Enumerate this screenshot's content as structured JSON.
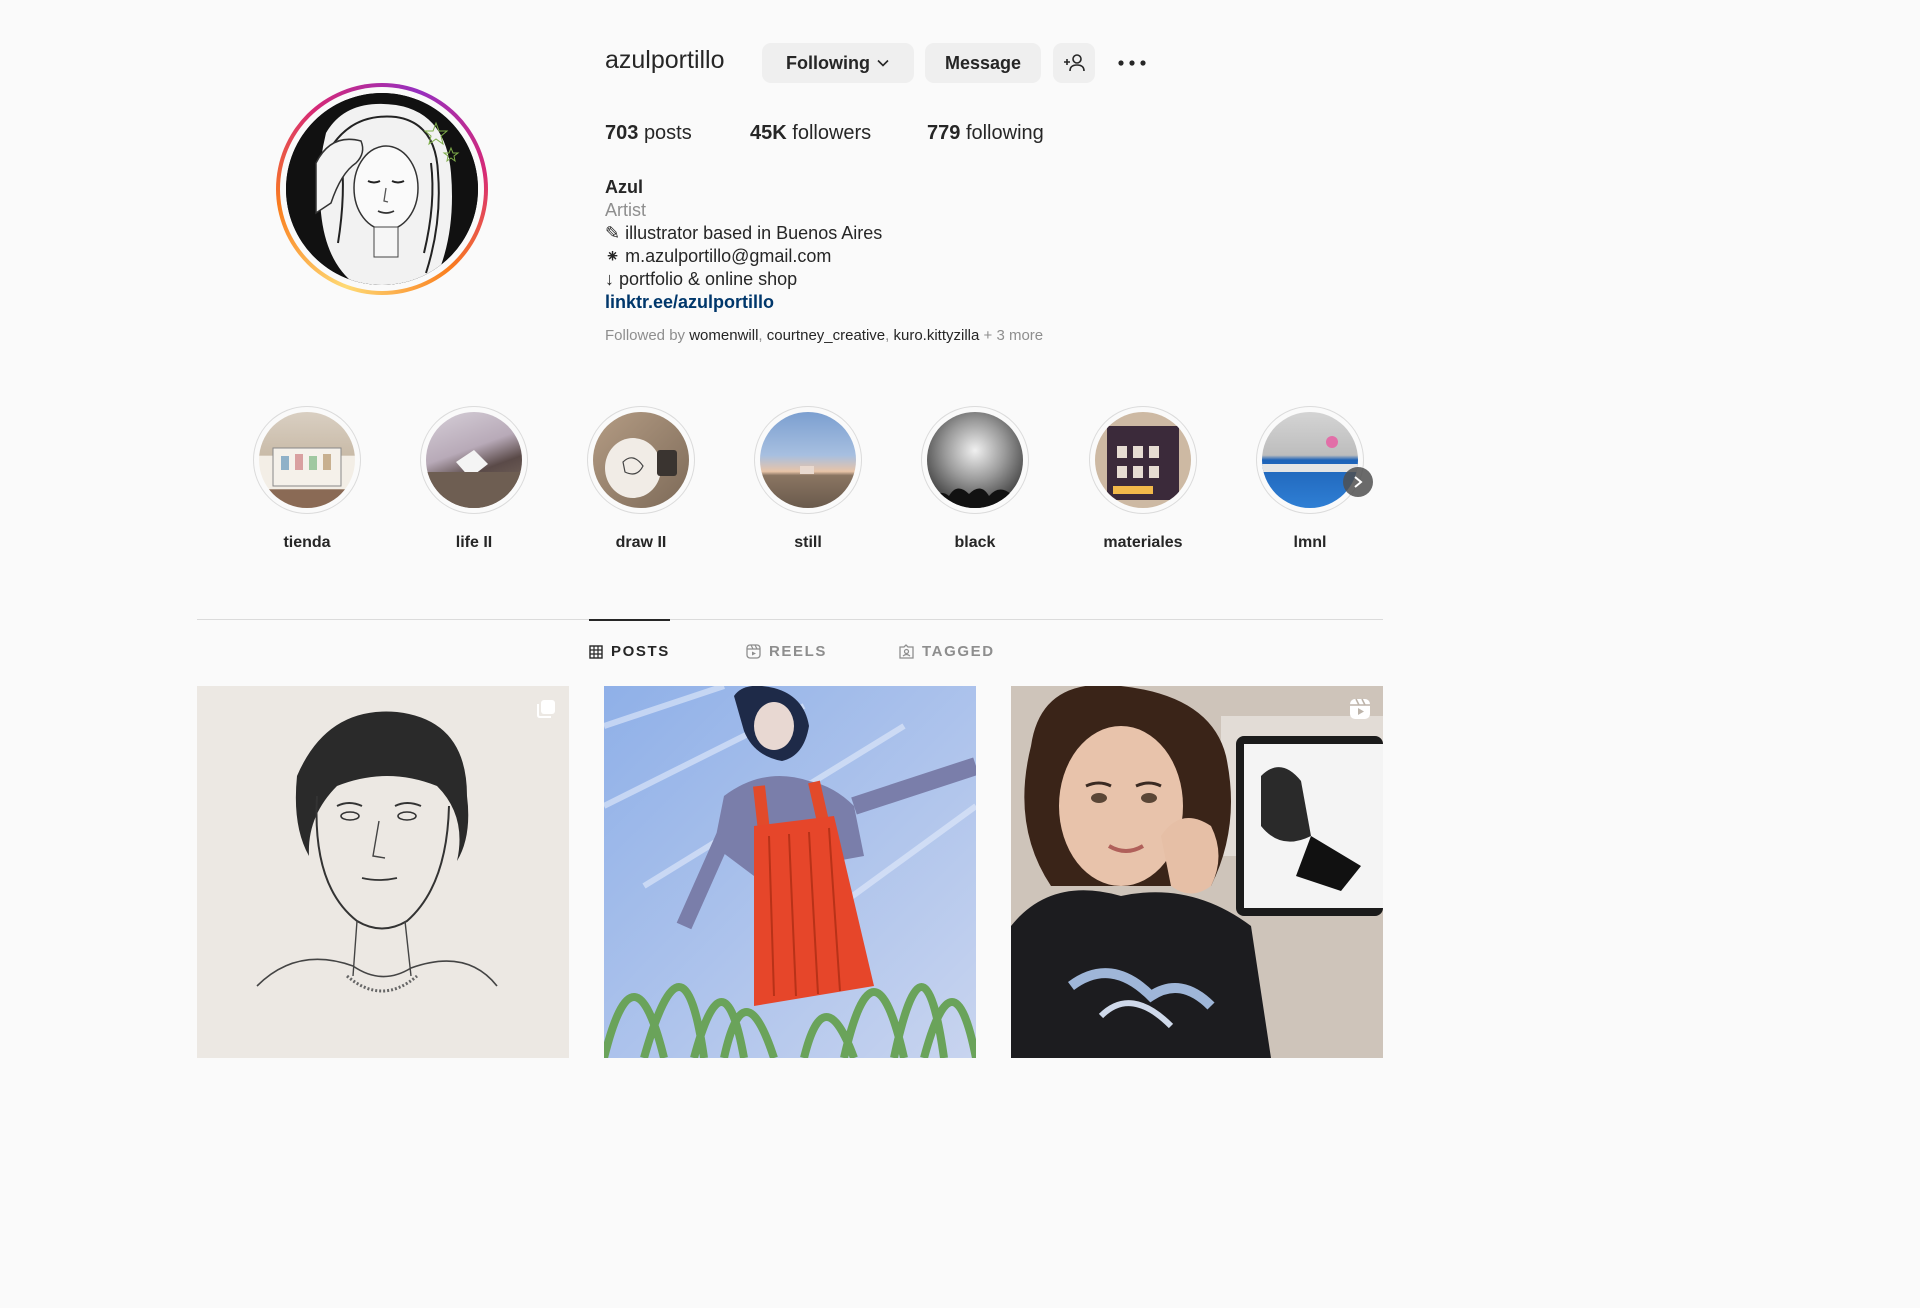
{
  "profile": {
    "username": "azulportillo",
    "following_button": "Following",
    "message_button": "Message",
    "add_user_icon": "add-user-icon",
    "more_icon": "more-options-icon",
    "stats": {
      "posts_count": "703",
      "posts_label": "posts",
      "followers_count": "45K",
      "followers_label": "followers",
      "following_count": "779",
      "following_label": "following"
    },
    "bio": {
      "name": "Azul",
      "category": "Artist",
      "line1": "✎ illustrator based in Buenos Aires",
      "line2": "⁕ m.azulportillo@gmail.com",
      "line3": "↓ portfolio & online shop",
      "link": "linktr.ee/azulportillo"
    },
    "followed_by": {
      "prefix": "Followed by",
      "user1": "womenwill",
      "user2": "courtney_creative",
      "user3": "kuro.kittyzilla",
      "more": "+ 3 more"
    }
  },
  "highlights": [
    {
      "label": "tienda"
    },
    {
      "label": "life II"
    },
    {
      "label": "draw II"
    },
    {
      "label": "still"
    },
    {
      "label": "black"
    },
    {
      "label": "materiales"
    },
    {
      "label": "lmnl"
    }
  ],
  "tabs": [
    {
      "label": "POSTS",
      "icon": "grid-icon",
      "active": true
    },
    {
      "label": "REELS",
      "icon": "reels-icon",
      "active": false
    },
    {
      "label": "TAGGED",
      "icon": "tagged-icon",
      "active": false
    }
  ],
  "posts": [
    {
      "type": "carousel",
      "badge_icon": "carousel-icon"
    },
    {
      "type": "image"
    },
    {
      "type": "reel",
      "badge_icon": "reel-icon"
    }
  ],
  "colors": {
    "background": "#fafafa",
    "button_bg": "#efefef",
    "text_primary": "#262626",
    "text_secondary": "#8e8e8e",
    "link": "#00376b",
    "divider": "#dbdbdb"
  }
}
